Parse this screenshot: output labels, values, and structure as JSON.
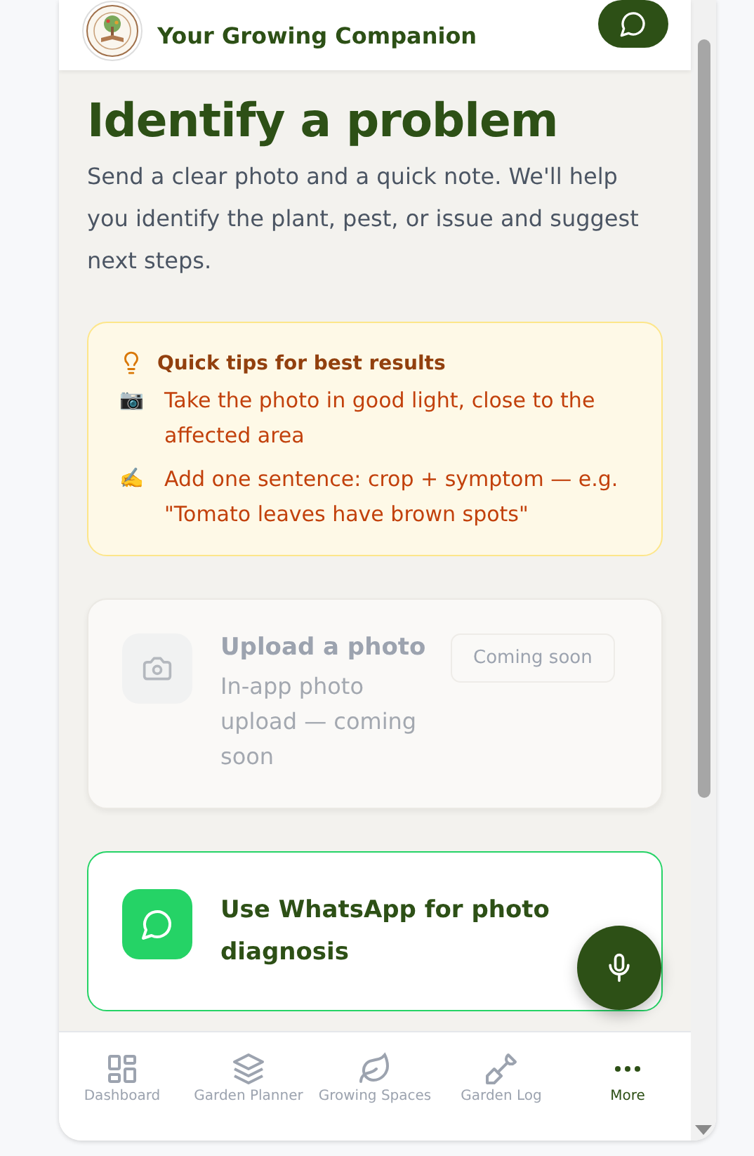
{
  "header": {
    "title": "Your Growing Companion"
  },
  "page": {
    "title": "Identify a problem",
    "intro": "Send a clear photo and a quick note. We'll help you identify the plant, pest, or issue and suggest next steps."
  },
  "tips": {
    "title": "Quick tips for best results",
    "items": [
      {
        "icon": "📷",
        "text": "Take the photo in good light, close to the affected area"
      },
      {
        "icon": "✍️",
        "text": "Add one sentence: crop + symptom — e.g. \"Tomato leaves have brown spots\""
      }
    ]
  },
  "upload": {
    "title": "Upload a photo",
    "description": "In-app photo upload — coming soon",
    "badge": "Coming soon",
    "disabled": true
  },
  "whatsapp": {
    "title": "Use WhatsApp for photo diagnosis"
  },
  "nav": [
    {
      "label": "Dashboard",
      "kind": "grid",
      "selected": false
    },
    {
      "label": "Garden Planner",
      "kind": "layers",
      "selected": false
    },
    {
      "label": "Growing Spaces",
      "kind": "leaf",
      "selected": false
    },
    {
      "label": "Garden Log",
      "kind": "shovel",
      "selected": false
    },
    {
      "label": "More",
      "kind": "dots",
      "selected": true
    }
  ]
}
